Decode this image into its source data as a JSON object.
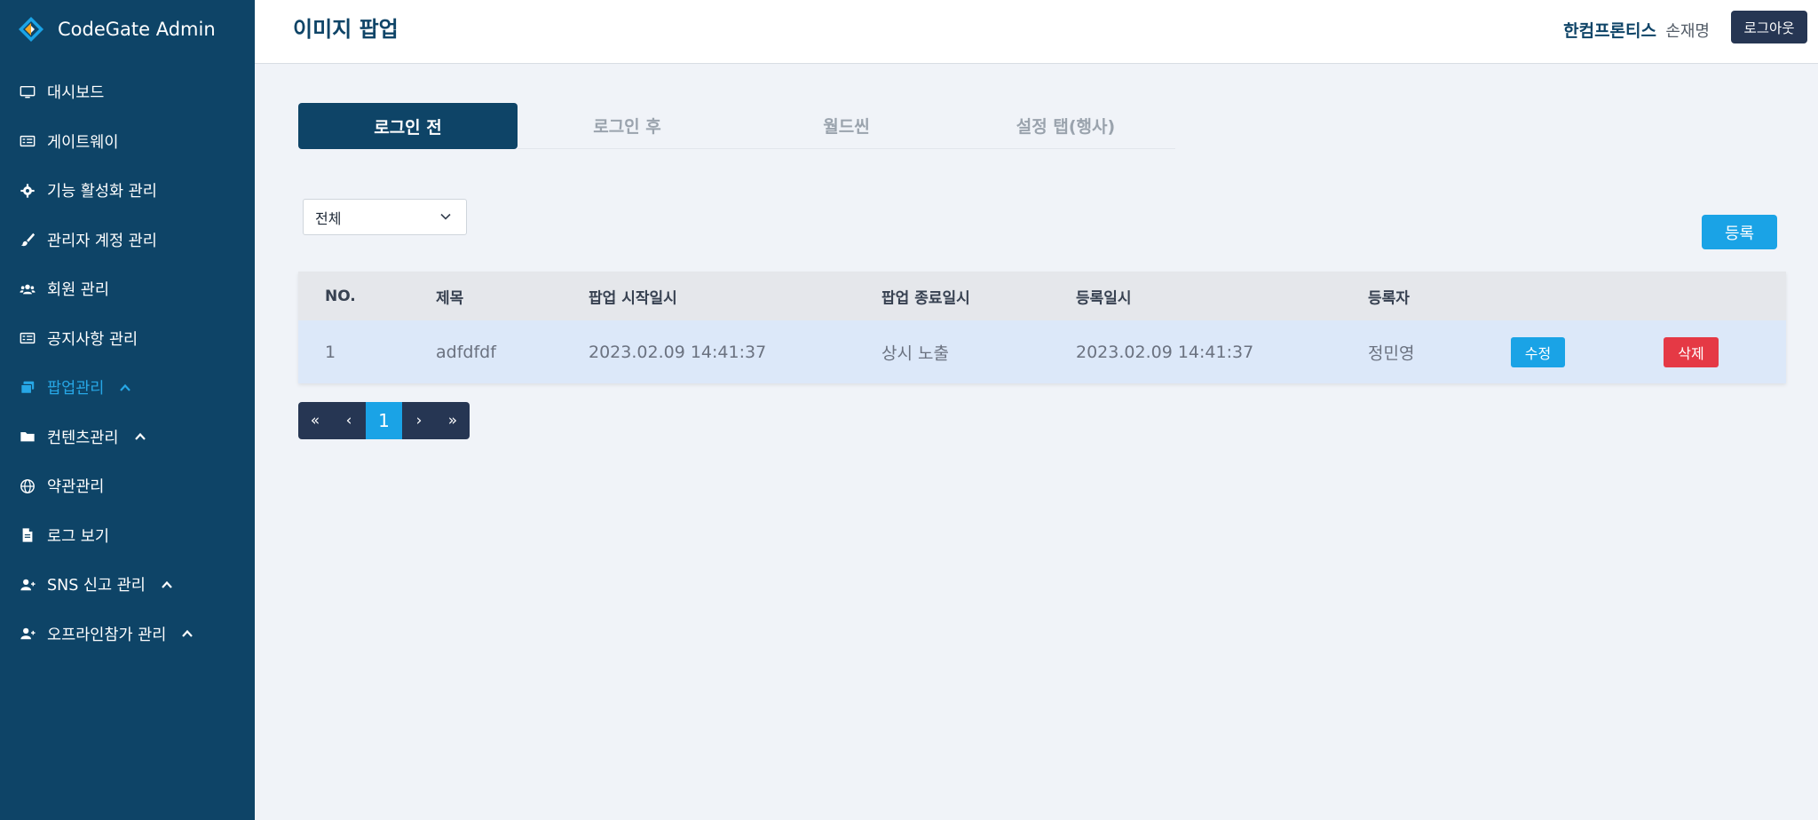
{
  "app": {
    "brand_name": "CodeGate Admin"
  },
  "sidebar": {
    "items": [
      {
        "label": "대시보드",
        "icon": "monitor-icon"
      },
      {
        "label": "게이트웨이",
        "icon": "gateway-icon"
      },
      {
        "label": "기능 활성화 관리",
        "icon": "gear-icon"
      },
      {
        "label": "관리자 계정 관리",
        "icon": "brush-icon"
      },
      {
        "label": "회원 관리",
        "icon": "users-icon"
      },
      {
        "label": "공지사항 관리",
        "icon": "notice-icon"
      },
      {
        "label": "팝업관리",
        "icon": "popup-icon",
        "active": true
      },
      {
        "label": "컨텐츠관리",
        "icon": "folder-icon"
      },
      {
        "label": "약관관리",
        "icon": "globe-icon"
      },
      {
        "label": "로그 보기",
        "icon": "file-icon"
      },
      {
        "label": "SNS 신고 관리",
        "icon": "user-plus-icon"
      },
      {
        "label": "오프라인참가 관리",
        "icon": "user-plus-icon"
      }
    ]
  },
  "header": {
    "title": "이미지 팝업",
    "org": "한컴프론티스",
    "user": "손재명",
    "logout_label": "로그아웃"
  },
  "tabs": [
    {
      "label": "로그인 전",
      "active": true
    },
    {
      "label": "로그인 후"
    },
    {
      "label": "월드씬"
    },
    {
      "label": "설정 탭(행사)"
    }
  ],
  "filter": {
    "selected": "전체"
  },
  "register_label": "등록",
  "table": {
    "headers": [
      "NO.",
      "제목",
      "팝업 시작일시",
      "팝업 종료일시",
      "등록일시",
      "등록자"
    ],
    "rows": [
      {
        "no": "1",
        "title": "adfdfdf",
        "start": "2023.02.09 14:41:37",
        "end": "상시 노출",
        "registered": "2023.02.09 14:41:37",
        "author": "정민영",
        "edit_label": "수정",
        "delete_label": "삭제"
      }
    ]
  },
  "pagination": {
    "first": "«",
    "prev": "‹",
    "current": "1",
    "next": "›",
    "last": "»"
  },
  "colors": {
    "sidebar_bg": "#0e4467",
    "accent": "#1aa3e6",
    "danger": "#e53945",
    "dark_button": "#263653",
    "active_nav": "#27a7e6"
  }
}
